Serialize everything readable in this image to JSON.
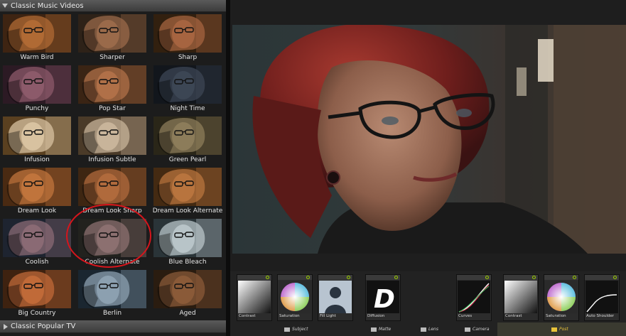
{
  "colors": {
    "accent_circle": "#d6151c",
    "panel_bg": "#1c1c1c",
    "header_bg": "#4a4a4a",
    "post_label": "#e8c33a"
  },
  "categories": {
    "current": "Classic Music Videos",
    "next": "Classic Popular TV"
  },
  "presets": [
    {
      "label": "Warm Bird",
      "tone": "#b06a34",
      "dark": "#3e2412"
    },
    {
      "label": "Sharper",
      "tone": "#9a6a4a",
      "dark": "#2e2218"
    },
    {
      "label": "Sharp",
      "tone": "#a66440",
      "dark": "#32200f"
    },
    {
      "label": "Punchy",
      "tone": "#8c5a6a",
      "dark": "#2c1a24"
    },
    {
      "label": "Pop Star",
      "tone": "#b07048",
      "dark": "#3a2414"
    },
    {
      "label": "Night Time",
      "tone": "#3c4654",
      "dark": "#12161c"
    },
    {
      "label": "Infusion",
      "tone": "#d8c2a0",
      "dark": "#5a4020"
    },
    {
      "label": "Infusion Subtle",
      "tone": "#c8b49a",
      "dark": "#4a3a28"
    },
    {
      "label": "Green Pearl",
      "tone": "#8c7c5a",
      "dark": "#2a2618"
    },
    {
      "label": "Dream Look",
      "tone": "#c0743c",
      "dark": "#4a2a12"
    },
    {
      "label": "Dream Look Sharp",
      "tone": "#b06a3c",
      "dark": "#3e2612"
    },
    {
      "label": "Dream Look Alternate",
      "tone": "#b8743e",
      "dark": "#442a12"
    },
    {
      "label": "Coolish",
      "tone": "#8a6a74",
      "dark": "#1e2430"
    },
    {
      "label": "Coolish Alternate",
      "tone": "#8c7070",
      "dark": "#22221e"
    },
    {
      "label": "Blue Bleach",
      "tone": "#b8c4c8",
      "dark": "#2a3438"
    },
    {
      "label": "Big Country",
      "tone": "#c06a38",
      "dark": "#3e2210"
    },
    {
      "label": "Berlin",
      "tone": "#8ca0b0",
      "dark": "#1a2630"
    },
    {
      "label": "Aged",
      "tone": "#8a5a38",
      "dark": "#2a1c10"
    }
  ],
  "tools": [
    {
      "label": "Contrast",
      "icon": "contrast-gradient-icon"
    },
    {
      "label": "Saturation",
      "icon": "color-wheel-icon"
    },
    {
      "label": "Fill Light",
      "icon": "portrait-silhouette-icon"
    },
    {
      "label": "Diffusion",
      "icon": "letter-d-icon"
    },
    {
      "label": "Curves",
      "icon": "curves-icon"
    },
    {
      "label": "Contrast",
      "icon": "contrast-gradient-icon"
    },
    {
      "label": "Saturation",
      "icon": "color-wheel-icon"
    },
    {
      "label": "Auto Shoulder",
      "icon": "shoulder-curve-icon"
    }
  ],
  "groups": {
    "subject": "Subject",
    "matte": "Matte",
    "lens": "Lens",
    "camera": "Camera",
    "post": "Post"
  },
  "diffusion_letter": "D"
}
